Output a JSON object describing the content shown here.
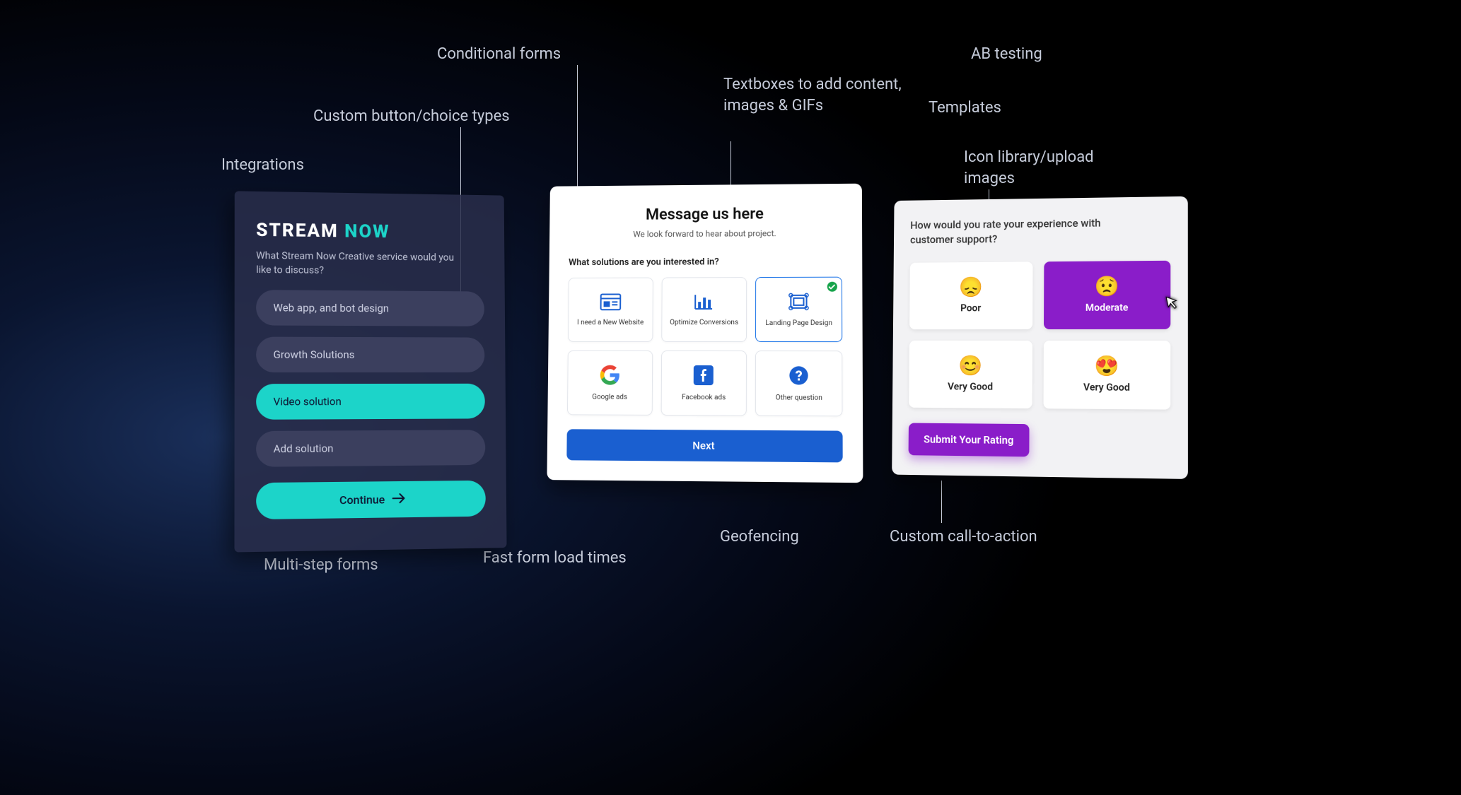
{
  "labels": {
    "integrations": "Integrations",
    "custom_button": "Custom button/choice types",
    "conditional_forms": "Conditional forms",
    "textboxes": "Textboxes to add content, images & GIFs",
    "ab_testing": "AB testing",
    "templates": "Templates",
    "icon_library": "Icon library/upload images",
    "multi_step": "Multi-step forms",
    "fast_load": "Fast form load times",
    "geofencing": "Geofencing",
    "custom_cta": "Custom call-to-action"
  },
  "card1": {
    "logo_a": "STREAM",
    "logo_b": "NOW",
    "question": "What Stream Now Creative service would you like to discuss?",
    "options": [
      {
        "label": "Web app, and bot design",
        "selected": false
      },
      {
        "label": "Growth Solutions",
        "selected": false
      },
      {
        "label": "Video solution",
        "selected": true
      },
      {
        "label": "Add solution",
        "selected": false
      }
    ],
    "continue": "Continue"
  },
  "card2": {
    "title": "Message us here",
    "subtitle": "We look forward to hear about project.",
    "question": "What solutions are you interested in?",
    "tiles": [
      {
        "label": "I need a New Website",
        "icon": "website",
        "selected": false
      },
      {
        "label": "Optimize Conversions",
        "icon": "chart",
        "selected": false
      },
      {
        "label": "Landing Page Design",
        "icon": "landing",
        "selected": true
      },
      {
        "label": "Google ads",
        "icon": "google",
        "selected": false
      },
      {
        "label": "Facebook ads",
        "icon": "facebook",
        "selected": false
      },
      {
        "label": "Other question",
        "icon": "question",
        "selected": false
      }
    ],
    "next": "Next"
  },
  "card3": {
    "question": "How would you rate your experience with customer support?",
    "tiles": [
      {
        "label": "Poor",
        "emoji": "😞",
        "selected": false
      },
      {
        "label": "Moderate",
        "emoji": "😟",
        "selected": true
      },
      {
        "label": "Very Good",
        "emoji": "😊",
        "selected": false
      },
      {
        "label": "Very Good",
        "emoji": "😍",
        "selected": false
      }
    ],
    "submit": "Submit Your Rating"
  },
  "colors": {
    "teal": "#1cd4c9",
    "blue": "#1a5fd0",
    "purple": "#8a1dc9"
  }
}
